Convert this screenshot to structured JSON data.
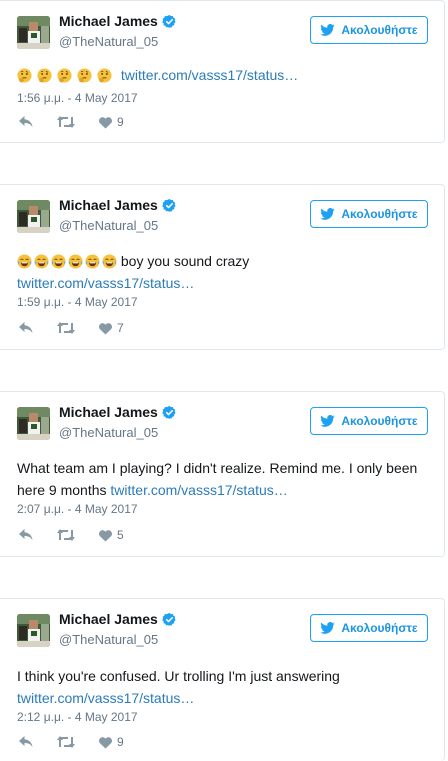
{
  "follow_label": "Ακολουθήστε",
  "user": {
    "name": "Michael James",
    "handle": "@TheNatural_05"
  },
  "tweets": [
    {
      "emojis": "🤔🤔🤔🤔🤔",
      "text": "",
      "link": "twitter.com/vasss17/status…",
      "timestamp": "1:56 μ.μ. - 4 May 2017",
      "likes": "9"
    },
    {
      "emojis": "😂😂😂😂😂😂",
      "text": " boy you sound crazy",
      "link": "twitter.com/vasss17/status…",
      "timestamp": "1:59 μ.μ. - 4 May 2017",
      "likes": "7"
    },
    {
      "emojis": "",
      "text": "What team am I playing? I didn't realize. Remind me. I only been here 9 months",
      "link": "twitter.com/vasss17/status…",
      "timestamp": "2:07 μ.μ. - 4 May 2017",
      "likes": "5"
    },
    {
      "emojis": "",
      "text": "I think you're confused. Ur trolling I'm just answering",
      "link": "twitter.com/vasss17/status…",
      "timestamp": "2:12 μ.μ. - 4 May 2017",
      "likes": "9"
    }
  ],
  "colors": {
    "link": "#2b7bb9",
    "accent": "#1da1f2",
    "muted": "#657786"
  },
  "icons": [
    "verified-icon",
    "twitter-bird-icon",
    "reply-icon",
    "retweet-icon",
    "heart-icon"
  ]
}
